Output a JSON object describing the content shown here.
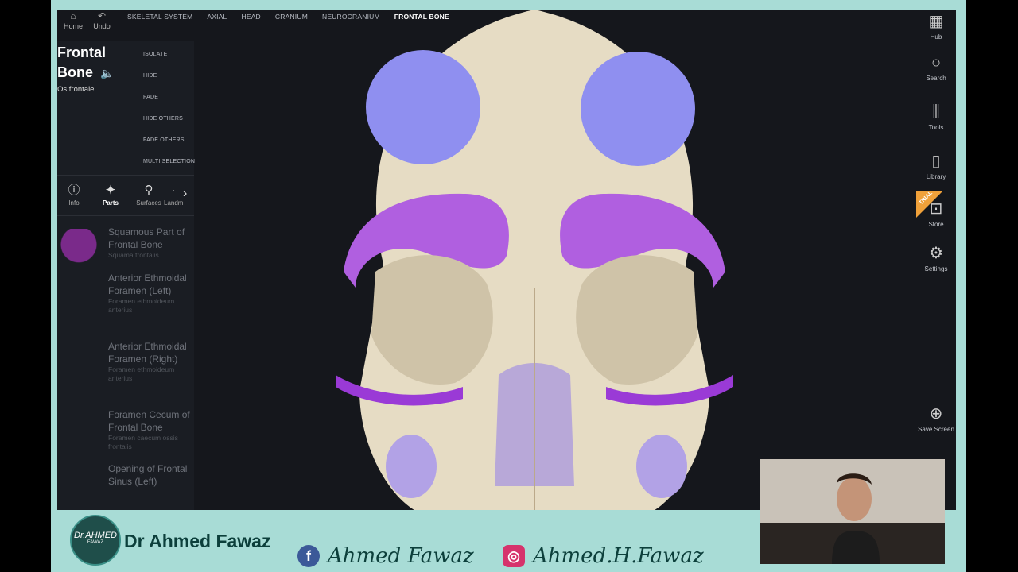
{
  "topbar": {
    "home_label": "Home",
    "undo_label": "Undo",
    "breadcrumbs": [
      "SKELETAL SYSTEM",
      "AXIAL",
      "HEAD",
      "CRANIUM",
      "NEUROCRANIUM",
      "FRONTAL BONE"
    ]
  },
  "structure": {
    "title_line1": "Frontal",
    "title_line2": "Bone",
    "latin": "Os frontale"
  },
  "actions": [
    "ISOLATE",
    "HIDE",
    "FADE",
    "HIDE OTHERS",
    "FADE OTHERS",
    "MULTI SELECTION"
  ],
  "tabs": [
    {
      "label": "Info",
      "icon": "info-icon"
    },
    {
      "label": "Parts",
      "icon": "bone-icon"
    },
    {
      "label": "Surfaces",
      "icon": "bone-icon"
    },
    {
      "label": "Landm",
      "icon": "landmark-icon"
    }
  ],
  "parts": [
    {
      "name": "Squamous Part of Frontal Bone",
      "latin": "Squama frontalis"
    },
    {
      "name": "Anterior Ethmoidal Foramen (Left)",
      "latin": "Foramen ethmoideum anterius"
    },
    {
      "name": "Anterior Ethmoidal Foramen (Right)",
      "latin": "Foramen ethmoideum anterius"
    },
    {
      "name": "Foramen Cecum of Frontal Bone",
      "latin": "Foramen caecum ossis frontalis"
    },
    {
      "name": "Opening of Frontal Sinus (Left)",
      "latin": ""
    }
  ],
  "right_bar": {
    "hub": "Hub",
    "search": "Search",
    "tools": "Tools",
    "library": "Library",
    "store": "Store",
    "settings": "Settings",
    "save_screen": "Save Screen",
    "trial_badge": "TRIAL"
  },
  "footer": {
    "logo_line1": "Dr.AHMED",
    "logo_line2": "FAWAZ",
    "name": "Dr Ahmed Fawaz",
    "facebook_handle": "Ahmed Fawaz",
    "instagram_handle": "Ahmed.H.Fawaz"
  },
  "colors": {
    "app_bg": "#15171c",
    "frame": "#a8dcd6",
    "bone": "#e6dcc4",
    "attachment_purple": "#b05fe0",
    "attachment_blue": "#8f8ff0"
  }
}
